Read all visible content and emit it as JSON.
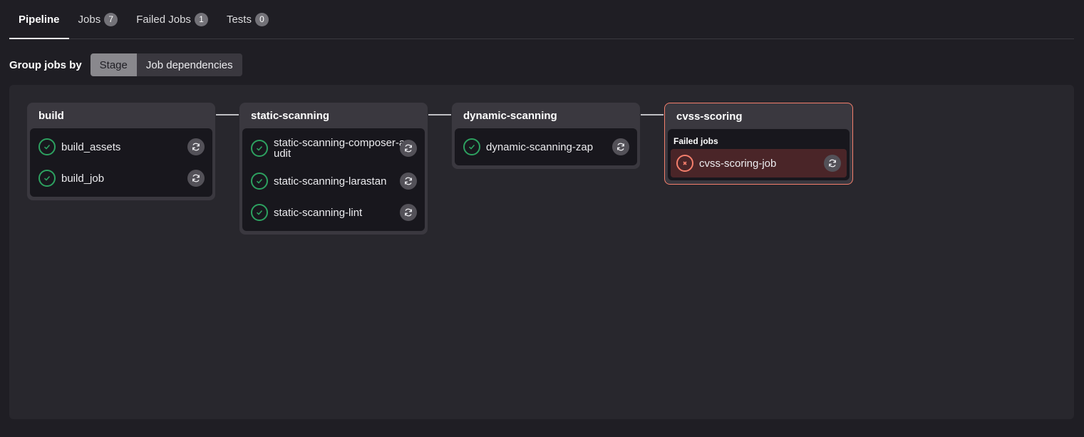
{
  "tabs": [
    {
      "label": "Pipeline",
      "count": null
    },
    {
      "label": "Jobs",
      "count": "7"
    },
    {
      "label": "Failed Jobs",
      "count": "1"
    },
    {
      "label": "Tests",
      "count": "0"
    }
  ],
  "group_by": {
    "label": "Group jobs by",
    "options": [
      "Stage",
      "Job dependencies"
    ],
    "selected": "Stage"
  },
  "stages": [
    {
      "name": "build",
      "jobs": [
        "build_assets",
        "build_job"
      ]
    },
    {
      "name": "static-scanning",
      "jobs": [
        "static-scanning-composer-audit",
        "static-scanning-larastan",
        "static-scanning-lint"
      ]
    },
    {
      "name": "dynamic-scanning",
      "jobs": [
        "dynamic-scanning-zap"
      ]
    },
    {
      "name": "cvss-scoring",
      "failed_label": "Failed jobs",
      "jobs": [
        "cvss-scoring-job"
      ]
    }
  ],
  "colors": {
    "success": "#2da160",
    "failed": "#f57f6c"
  }
}
